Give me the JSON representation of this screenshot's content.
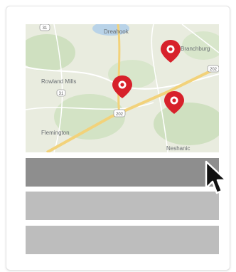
{
  "map": {
    "labels": {
      "dreahook": "Dreahook",
      "branchburg": "Branchburg",
      "rowland_mills": "Rowland Mills",
      "flemington": "Flemington",
      "neshanic": "Neshanic"
    },
    "route_shields": [
      "31",
      "202",
      "202",
      "31"
    ],
    "pin_color": "#d7212b"
  },
  "list": {
    "item_count": 3,
    "active_item": 1
  },
  "colors": {
    "active_bar": "#8e8e8e",
    "inactive_bar": "#bdbdbd"
  }
}
